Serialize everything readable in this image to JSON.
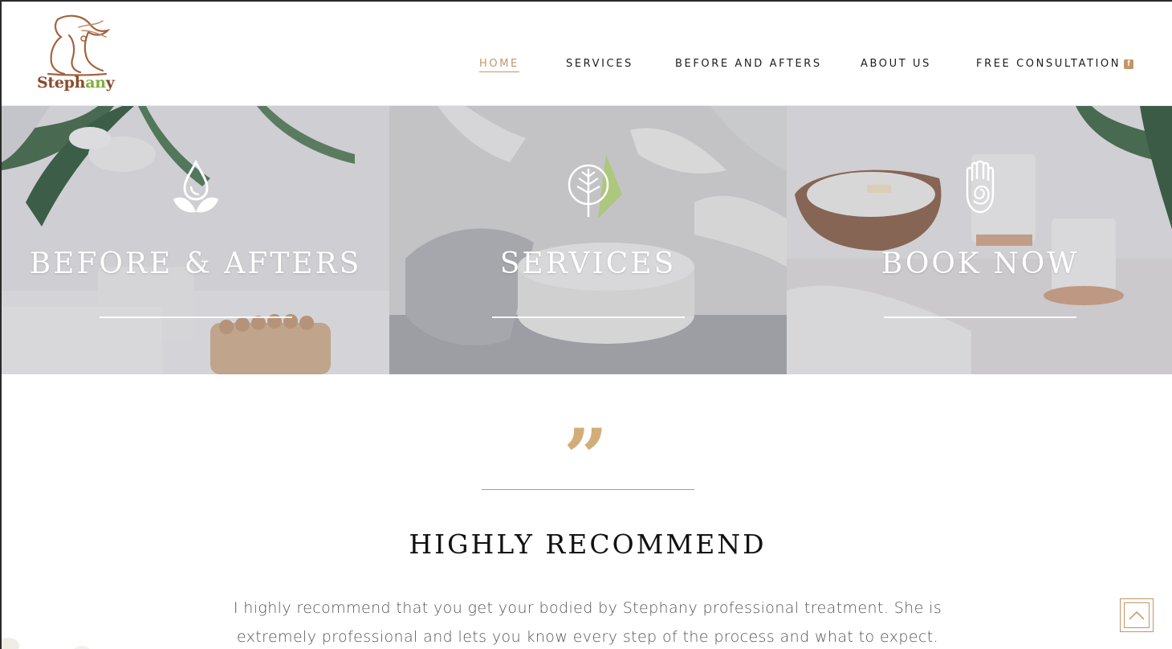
{
  "brand": {
    "name_part1": "Steph",
    "name_accent": "an",
    "name_part2": "y",
    "colors": {
      "accent": "#c39566",
      "brand_brown": "#8a4a2c",
      "brand_green": "#7fae3a"
    }
  },
  "nav": {
    "items": [
      {
        "label": "HOME",
        "active": true
      },
      {
        "label": "SERVICES",
        "active": false
      },
      {
        "label": "BEFORE AND AFTERS",
        "active": false
      },
      {
        "label": "ABOUT US",
        "active": false
      },
      {
        "label": "FREE CONSULTATION",
        "active": false
      }
    ],
    "social_icon": "facebook-icon",
    "social_glyph": "f"
  },
  "panels": [
    {
      "title": "BEFORE & AFTERS",
      "icon": "water-drop-leaves-icon"
    },
    {
      "title": "SERVICES",
      "icon": "leaf-tree-icon"
    },
    {
      "title": "BOOK NOW",
      "icon": "hamsa-hand-icon"
    }
  ],
  "testimonial": {
    "quote_icon": "quote-icon",
    "quote_glyph": "”",
    "title": "HIGHLY RECOMMEND",
    "text": "I highly recommend that you get your bodied by Stephany professional treatment. She is extremely professional and lets you know every step of the process and what to expect. It’s a very relaxing"
  },
  "back_to_top": {
    "icon": "chevron-up-icon"
  }
}
